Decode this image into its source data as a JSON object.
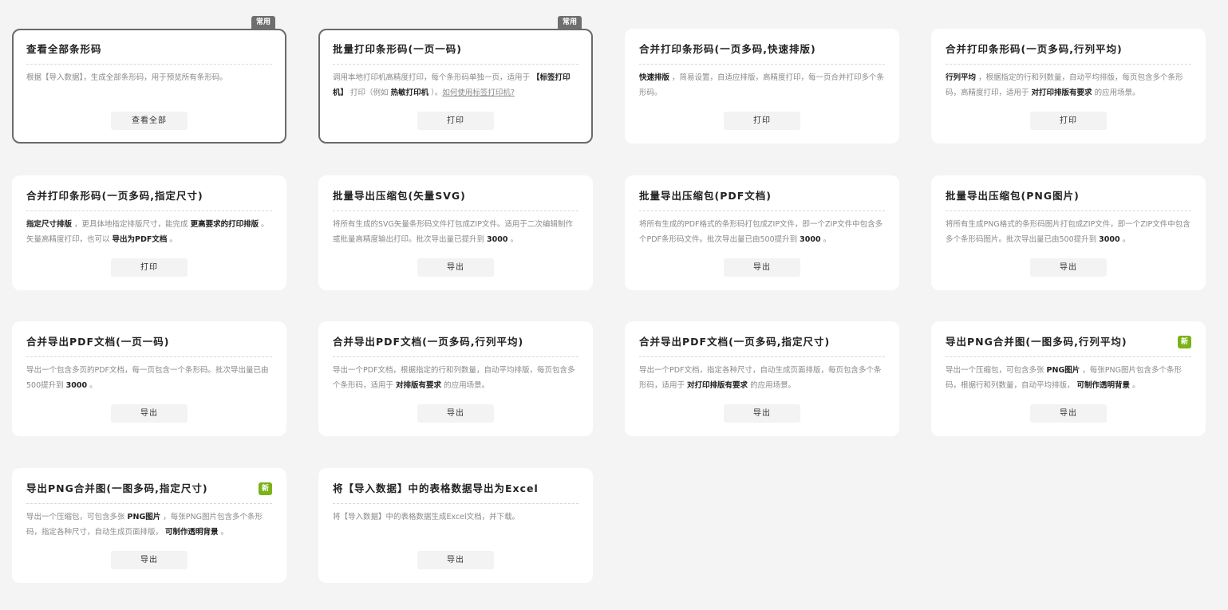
{
  "cards": [
    {
      "title": "查看全部条形码",
      "tag": "常用",
      "tag_type": "common",
      "desc": [
        {
          "t": "根据【导入数据】，生成全部条形码，用于预览所有条形码。"
        }
      ],
      "button": "查看全部"
    },
    {
      "title": "批量打印条形码(一页一码)",
      "tag": "常用",
      "tag_type": "common",
      "desc": [
        {
          "t": "调用本地打印机高精度打印，每个条形码单独一页，适用于 "
        },
        {
          "t": "【标签打印机】",
          "b": true
        },
        {
          "t": " 打印（例如 "
        },
        {
          "t": "热敏打印机",
          "b": true
        },
        {
          "t": " ）。"
        },
        {
          "t": "如何使用标签打印机?",
          "u": true
        }
      ],
      "button": "打印"
    },
    {
      "title": "合并打印条形码(一页多码,快速排版)",
      "desc": [
        {
          "t": "快速排版",
          "b": true
        },
        {
          "t": " ，简易设置，自适应排版，高精度打印，每一页合并打印多个条形码。"
        }
      ],
      "button": "打印"
    },
    {
      "title": "合并打印条形码(一页多码,行列平均)",
      "desc": [
        {
          "t": "行列平均",
          "b": true
        },
        {
          "t": " ，根据指定的行和列数量，自动平均排版，每页包含多个条形码，高精度打印，适用于 "
        },
        {
          "t": "对打印排版有要求",
          "b": true
        },
        {
          "t": " 的应用场景。"
        }
      ],
      "button": "打印"
    },
    {
      "title": "合并打印条形码(一页多码,指定尺寸)",
      "desc": [
        {
          "t": "指定尺寸排版",
          "b": true
        },
        {
          "t": " ，更具体地指定排版尺寸，能完成 "
        },
        {
          "t": "更高要求的打印排版",
          "b": true
        },
        {
          "t": " 。矢量高精度打印，也可以 "
        },
        {
          "t": "导出为PDF文档",
          "b": true
        },
        {
          "t": " 。"
        }
      ],
      "button": "打印"
    },
    {
      "title": "批量导出压缩包(矢量SVG)",
      "desc": [
        {
          "t": "将所有生成的SVG矢量条形码文件打包成ZIP文件。适用于二次编辑制作或批量高精度输出打印。批次导出量已提升到 "
        },
        {
          "t": "3000",
          "b": true
        },
        {
          "t": " 。"
        }
      ],
      "button": "导出"
    },
    {
      "title": "批量导出压缩包(PDF文档)",
      "desc": [
        {
          "t": "将所有生成的PDF格式的条形码打包成ZIP文件，即一个ZIP文件中包含多个PDF条形码文件。批次导出量已由500提升到 "
        },
        {
          "t": "3000",
          "b": true
        },
        {
          "t": " 。"
        }
      ],
      "button": "导出"
    },
    {
      "title": "批量导出压缩包(PNG图片)",
      "desc": [
        {
          "t": "将所有生成PNG格式的条形码图片打包成ZIP文件，即一个ZIP文件中包含多个条形码图片。批次导出量已由500提升到 "
        },
        {
          "t": "3000",
          "b": true
        },
        {
          "t": " 。"
        }
      ],
      "button": "导出"
    },
    {
      "title": "合并导出PDF文档(一页一码)",
      "desc": [
        {
          "t": "导出一个包含多页的PDF文档，每一页包含一个条形码。批次导出量已由500提升到 "
        },
        {
          "t": "3000",
          "b": true
        },
        {
          "t": " 。"
        }
      ],
      "button": "导出"
    },
    {
      "title": "合并导出PDF文档(一页多码,行列平均)",
      "desc": [
        {
          "t": "导出一个PDF文档，根据指定的行和列数量，自动平均排版，每页包含多个条形码，适用于 "
        },
        {
          "t": "对排版有要求",
          "b": true
        },
        {
          "t": " 的应用场景。"
        }
      ],
      "button": "导出"
    },
    {
      "title": "合并导出PDF文档(一页多码,指定尺寸)",
      "desc": [
        {
          "t": "导出一个PDF文档，指定各种尺寸，自动生成页面排版，每页包含多个条形码，适用于 "
        },
        {
          "t": "对打印排版有要求",
          "b": true
        },
        {
          "t": " 的应用场景。"
        }
      ],
      "button": "导出"
    },
    {
      "title": "导出PNG合并图(一图多码,行列平均)",
      "tag": "新",
      "tag_type": "new",
      "desc": [
        {
          "t": "导出一个压缩包，可包含多张 "
        },
        {
          "t": "PNG图片",
          "b": true
        },
        {
          "t": " ，每张PNG图片包含多个条形码，根据行和列数量，自动平均排版， "
        },
        {
          "t": "可制作透明背景",
          "b": true
        },
        {
          "t": " 。"
        }
      ],
      "button": "导出"
    },
    {
      "title": "导出PNG合并图(一图多码,指定尺寸)",
      "tag": "新",
      "tag_type": "new",
      "desc": [
        {
          "t": "导出一个压缩包，可包含多张 "
        },
        {
          "t": "PNG图片",
          "b": true
        },
        {
          "t": " ，每张PNG图片包含多个条形码，指定各种尺寸，自动生成页面排版， "
        },
        {
          "t": "可制作透明背景",
          "b": true
        },
        {
          "t": " 。"
        }
      ],
      "button": "导出"
    },
    {
      "title": "将【导入数据】中的表格数据导出为Excel",
      "desc": [
        {
          "t": "将【导入数据】中的表格数据生成Excel文档，并下载。"
        }
      ],
      "button": "导出"
    }
  ],
  "colors": {
    "background": "#f3f4f3",
    "card": "#ffffff",
    "common_border": "#6a6a6a",
    "tag_common": "#6f6f6f",
    "tag_new": "#7ab317",
    "button_bg": "#f2f3f2",
    "text_strong": "#222222",
    "text_muted": "#8a8a8a"
  }
}
